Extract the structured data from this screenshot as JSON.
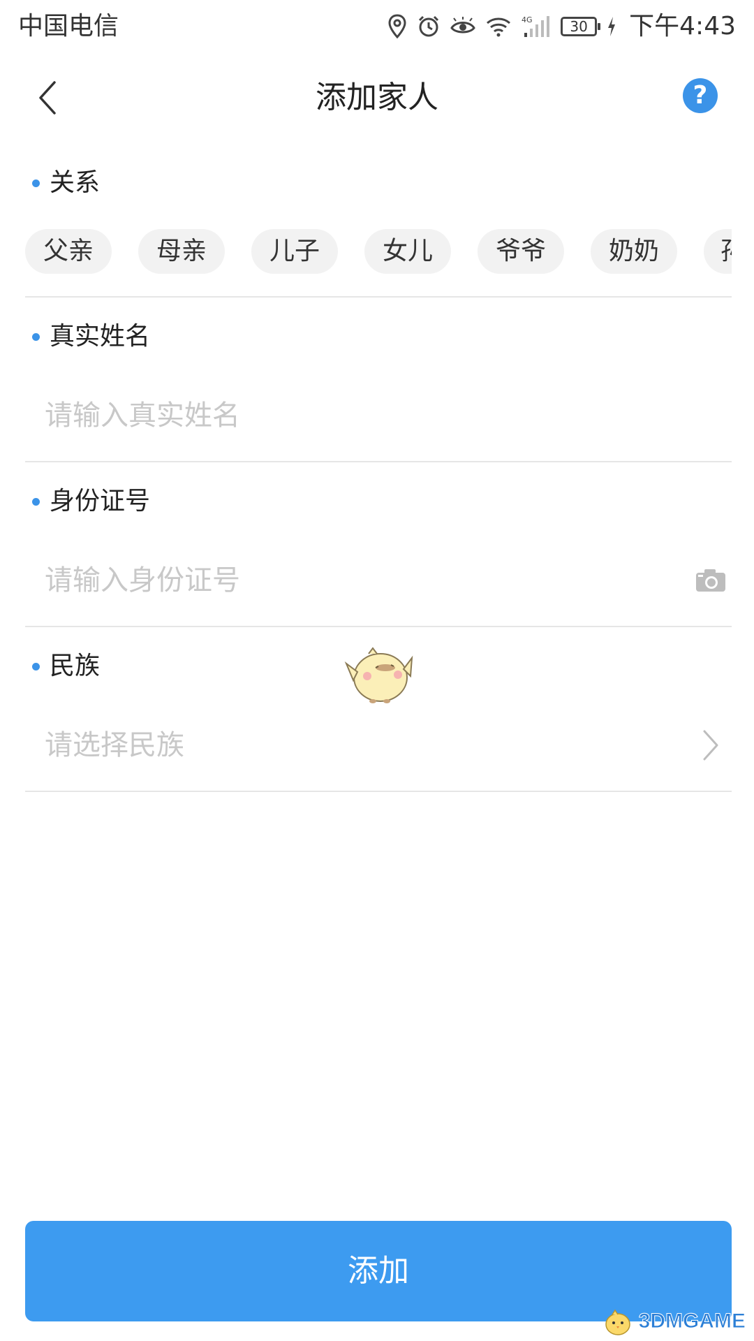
{
  "status_bar": {
    "carrier": "中国电信",
    "network": "4G",
    "battery": "30",
    "time": "下午4:43",
    "icons": [
      "location-icon",
      "alarm-icon",
      "eye-icon",
      "wifi-icon",
      "signal-icon",
      "battery-icon",
      "charging-icon"
    ]
  },
  "nav": {
    "title": "添加家人",
    "back_icon": "chevron-left-icon",
    "help_label": "?"
  },
  "form": {
    "relation": {
      "label": "关系",
      "options": [
        "父亲",
        "母亲",
        "儿子",
        "女儿",
        "爷爷",
        "奶奶",
        "孙"
      ]
    },
    "name": {
      "label": "真实姓名",
      "placeholder": "请输入真实姓名",
      "value": ""
    },
    "id_number": {
      "label": "身份证号",
      "placeholder": "请输入身份证号",
      "value": "",
      "icon": "camera-icon"
    },
    "ethnicity": {
      "label": "民族",
      "placeholder": "请选择民族",
      "value": "",
      "icon": "chevron-right-icon"
    }
  },
  "submit": {
    "label": "添加"
  },
  "watermark": {
    "text": "3DMGAME"
  },
  "colors": {
    "accent": "#3d9bf0",
    "placeholder": "#c8c8c8",
    "chip_bg": "#f2f2f2",
    "divider": "#e6e6e6"
  }
}
